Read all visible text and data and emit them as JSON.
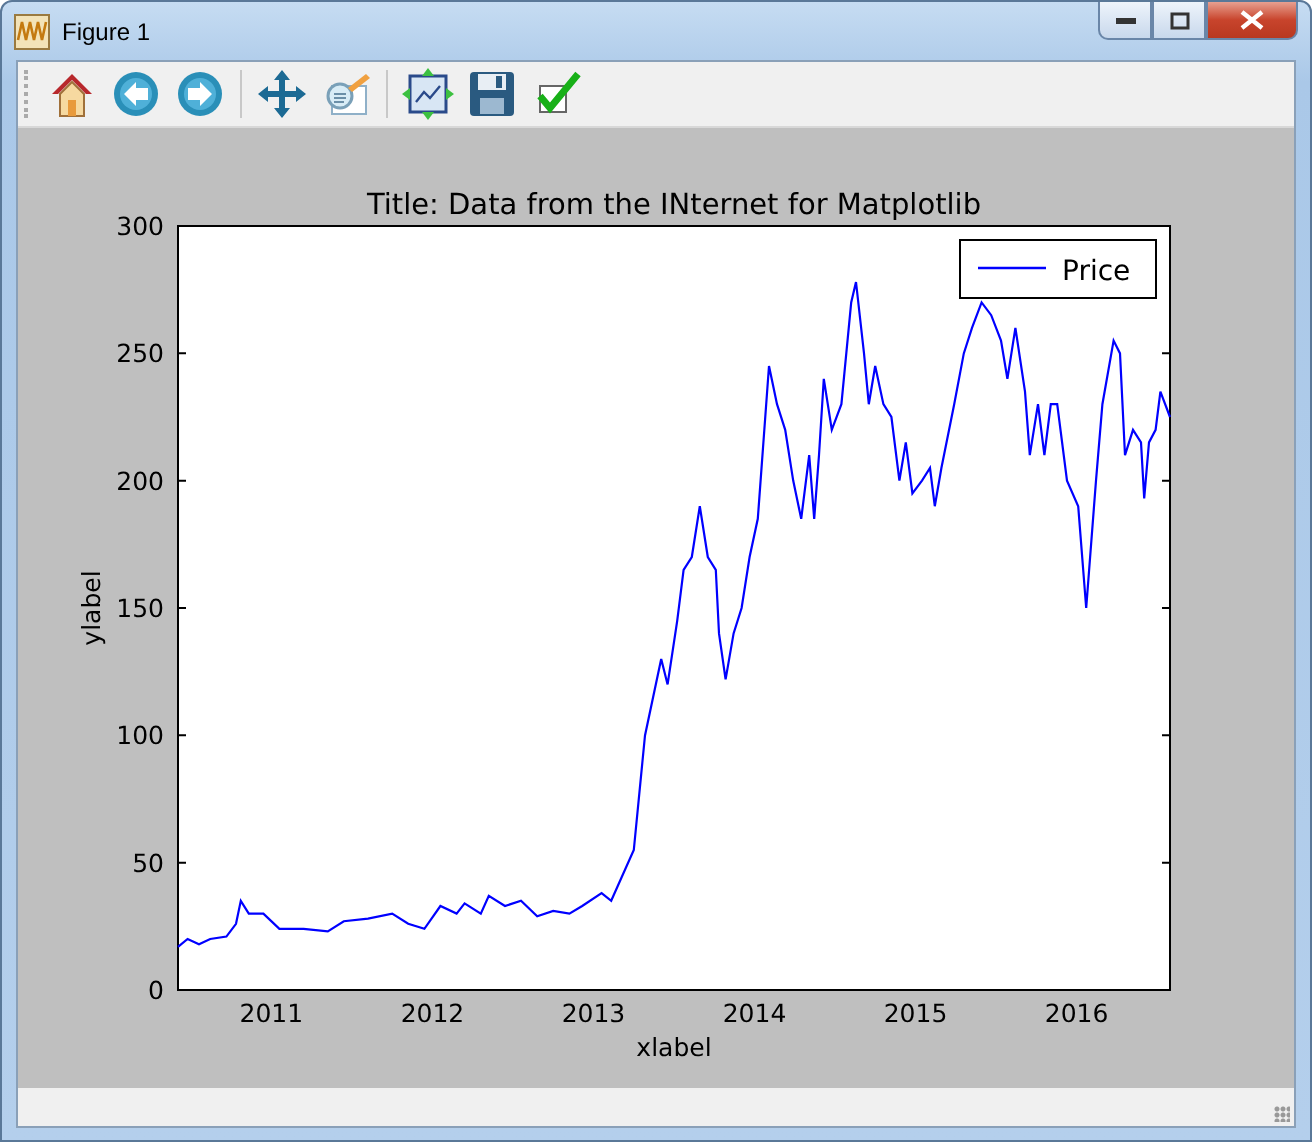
{
  "window": {
    "title": "Figure 1"
  },
  "toolbar": [
    {
      "kind": "home"
    },
    {
      "kind": "back"
    },
    {
      "kind": "forward"
    },
    {
      "kind": "separator"
    },
    {
      "kind": "pan"
    },
    {
      "kind": "zoom"
    },
    {
      "kind": "separator"
    },
    {
      "kind": "subplots"
    },
    {
      "kind": "save"
    },
    {
      "kind": "edit"
    }
  ],
  "figure": {
    "chart_data": {
      "type": "line",
      "title": "Title: Data from the INternet for Matplotlib",
      "xlabel": "xlabel",
      "ylabel": "ylabel",
      "x": [
        2010.42,
        2010.48,
        2010.55,
        2010.62,
        2010.72,
        2010.78,
        2010.81,
        2010.86,
        2010.95,
        2011.05,
        2011.2,
        2011.35,
        2011.45,
        2011.6,
        2011.75,
        2011.85,
        2011.95,
        2012.05,
        2012.15,
        2012.2,
        2012.3,
        2012.35,
        2012.45,
        2012.55,
        2012.65,
        2012.75,
        2012.85,
        2012.93,
        2013.05,
        2013.11,
        2013.25,
        2013.32,
        2013.42,
        2013.46,
        2013.52,
        2013.56,
        2013.61,
        2013.66,
        2013.71,
        2013.76,
        2013.78,
        2013.82,
        2013.87,
        2013.92,
        2013.97,
        2014.02,
        2014.09,
        2014.14,
        2014.19,
        2014.24,
        2014.29,
        2014.34,
        2014.37,
        2014.4,
        2014.43,
        2014.48,
        2014.54,
        2014.6,
        2014.63,
        2014.68,
        2014.71,
        2014.75,
        2014.8,
        2014.85,
        2014.9,
        2014.94,
        2014.98,
        2015.04,
        2015.09,
        2015.12,
        2015.16,
        2015.24,
        2015.3,
        2015.35,
        2015.41,
        2015.47,
        2015.53,
        2015.57,
        2015.62,
        2015.68,
        2015.71,
        2015.76,
        2015.8,
        2015.84,
        2015.88,
        2015.94,
        2016.01,
        2016.06,
        2016.12,
        2016.16,
        2016.23,
        2016.27,
        2016.3,
        2016.35,
        2016.4,
        2016.42,
        2016.45,
        2016.49,
        2016.52,
        2016.58
      ],
      "series": [
        {
          "name": "Price",
          "color": "#0000ff",
          "values": [
            17,
            20,
            18,
            20,
            21,
            26,
            35,
            30,
            30,
            24,
            24,
            23,
            27,
            28,
            30,
            26,
            24,
            33,
            30,
            34,
            30,
            37,
            33,
            35,
            29,
            31,
            30,
            33,
            38,
            35,
            55,
            100,
            130,
            120,
            145,
            165,
            170,
            190,
            170,
            165,
            140,
            122,
            140,
            150,
            170,
            185,
            245,
            230,
            220,
            200,
            185,
            210,
            185,
            210,
            240,
            220,
            230,
            270,
            278,
            250,
            230,
            245,
            230,
            225,
            200,
            215,
            195,
            200,
            205,
            190,
            205,
            230,
            250,
            260,
            270,
            265,
            255,
            240,
            260,
            235,
            210,
            230,
            210,
            230,
            230,
            200,
            190,
            150,
            200,
            230,
            255,
            250,
            210,
            220,
            215,
            193,
            215,
            220,
            235,
            225
          ]
        }
      ],
      "xlim": [
        2010.42,
        2016.58
      ],
      "ylim": [
        0,
        300
      ],
      "xticks": [
        {
          "value": 2011,
          "label": "2011"
        },
        {
          "value": 2012,
          "label": "2012"
        },
        {
          "value": 2013,
          "label": "2013"
        },
        {
          "value": 2014,
          "label": "2014"
        },
        {
          "value": 2015,
          "label": "2015"
        },
        {
          "value": 2016,
          "label": "2016"
        }
      ],
      "yticks": [
        0,
        50,
        100,
        150,
        200,
        250,
        300
      ]
    }
  }
}
